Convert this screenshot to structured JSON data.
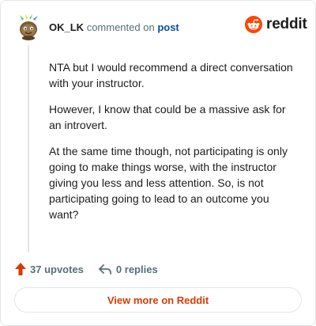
{
  "comment": {
    "username": "OK_LK",
    "action_text": "commented on",
    "post_link": "post",
    "paragraphs": [
      "NTA but I would recommend a direct conversation with your instructor.",
      "However, I know that could be a massive ask for an introvert.",
      "At the same time though, not participating is only going to make things worse, with the instructor giving you less and less attention. So, is not participating going to lead to an outcome you want?"
    ]
  },
  "brand": {
    "name": "reddit",
    "icon": "reddit-alien-icon",
    "color": "#ff4500"
  },
  "actions": {
    "upvotes_label": "37 upvotes",
    "replies_label": "0 replies",
    "upvote_icon": "upvote-arrow-icon",
    "reply_icon": "reply-arrow-icon",
    "upvote_color": "#d93a00"
  },
  "footer": {
    "view_more_label": "View more on Reddit"
  }
}
